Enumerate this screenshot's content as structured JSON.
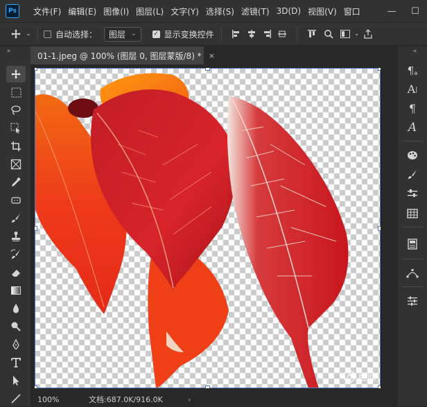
{
  "app": {
    "logo": "Ps"
  },
  "menu": {
    "items": [
      "文件(F)",
      "编辑(E)",
      "图像(I)",
      "图层(L)",
      "文字(Y)",
      "选择(S)",
      "滤镜(T)",
      "3D(D)",
      "视图(V)",
      "窗口"
    ]
  },
  "window_controls": {
    "minimize": "—",
    "maximize": "☐"
  },
  "options": {
    "auto_select_label": "自动选择：",
    "auto_select_checked": false,
    "layer_dropdown_value": "图层",
    "show_transform_label": "显示变换控件",
    "show_transform_checked": true
  },
  "document": {
    "tab_title": "01-1.jpeg @ 100% (图层 0, 图层蒙版/8) *",
    "close": "×"
  },
  "status": {
    "zoom": "100%",
    "doc_info": "文档:687.0K/916.0K",
    "arrow": "›"
  },
  "watermark": {
    "text": "经验"
  },
  "colors": {
    "accent": "#31a8ff",
    "leaf_red": "#d8232a",
    "leaf_orange": "#ee4a1c",
    "selection": "#4e78c4"
  },
  "icons": {
    "left_tools": [
      "move-icon",
      "marquee-icon",
      "lasso-icon",
      "object-select-icon",
      "crop-icon",
      "frame-icon",
      "eyedropper-icon",
      "healing-icon",
      "brush-icon",
      "stamp-icon",
      "history-brush-icon",
      "eraser-icon",
      "gradient-icon",
      "blur-icon",
      "dodge-icon",
      "pen-icon",
      "type-icon",
      "path-select-icon",
      "line-icon"
    ],
    "right_tools": [
      "paragraph-style-icon",
      "character-icon",
      "paragraph-icon",
      "glyph-icon",
      "palette-icon",
      "brush-panel-icon",
      "adjust-icon",
      "grid-icon",
      "layer-comp-icon",
      "path-icon",
      "properties-icon"
    ]
  }
}
